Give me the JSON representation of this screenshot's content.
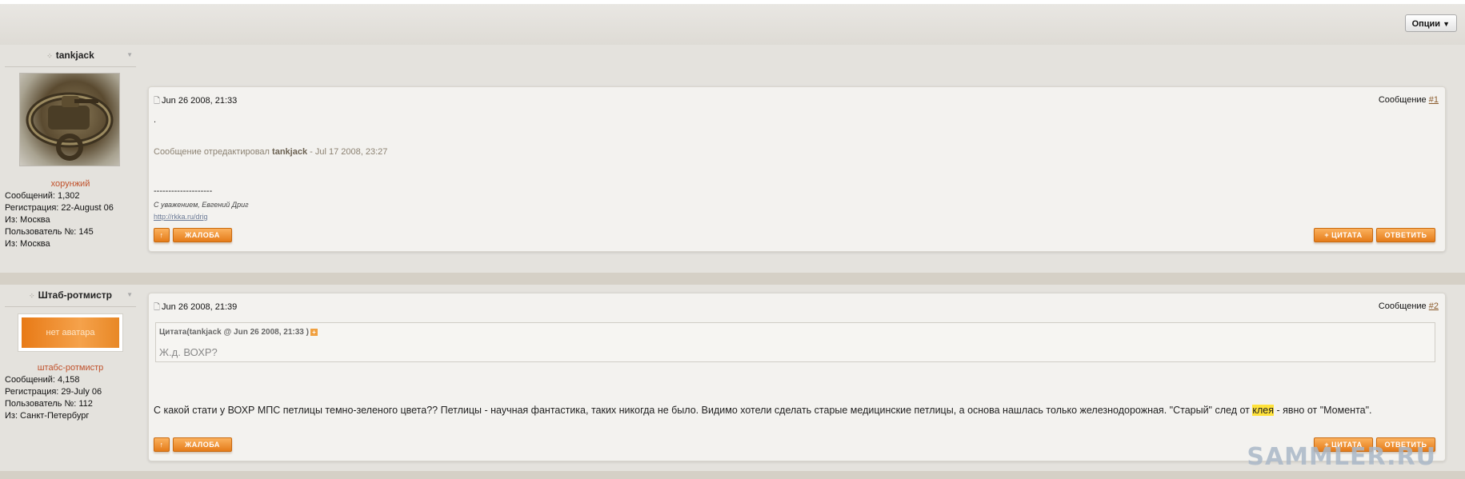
{
  "topbar": {
    "options_label": "Опции"
  },
  "posts": [
    {
      "author": "tankjack",
      "rank": "хорунжий",
      "stats": [
        "Сообщений: 1,302",
        "Регистрация: 22-August 06",
        "Из: Москва",
        "Пользователь №: 145",
        "Из: Москва"
      ],
      "date": "Jun 26 2008, 21:33",
      "post_label": "Сообщение",
      "post_num": "#1",
      "body_dot": ".",
      "edit_prefix": "Сообщение отредактировал",
      "edit_user": "tankjack",
      "edit_date": "- Jul 17 2008, 23:27",
      "sig_line": "--------------------",
      "sig_text": "С уважением, Евгений Дриг",
      "sig_link": "http://rkka.ru/drig",
      "buttons": {
        "up": "↑",
        "report": "ЖАЛОБА",
        "quote": "+ ЦИТАТА",
        "reply": "ОТВЕТИТЬ"
      }
    },
    {
      "author": "Штаб-ротмистр",
      "avatar_text": "нет аватара",
      "rank": "штабс-ротмистр",
      "stats": [
        "Сообщений: 4,158",
        "Регистрация: 29-July 06",
        "Пользователь №: 112",
        "Из: Санкт-Петербург"
      ],
      "date": "Jun 26 2008, 21:39",
      "post_label": "Сообщение",
      "post_num": "#2",
      "quote_head": "Цитата(tankjack @ Jun 26 2008, 21:33 )",
      "quote_text": "Ж.д. ВОХР?",
      "body_before": "С какой стати у ВОХР МПС петлицы темно-зеленого цвета?? Петлицы - научная фантастика, таких никогда не было. Видимо хотели сделать старые медицинские петлицы, а основа нашлась только железнодорожная. \"Старый\" след от ",
      "body_highlight": "клея",
      "body_after": " - явно от \"Момента\".",
      "buttons": {
        "up": "↑",
        "report": "ЖАЛОБА",
        "quote": "+ ЦИТАТА",
        "reply": "ОТВЕТИТЬ"
      }
    }
  ],
  "watermark": "SAMMLER.RU",
  "colors": {
    "accent": "#e57c1a",
    "rank": "#c0502a",
    "highlight": "#ffe23a"
  }
}
